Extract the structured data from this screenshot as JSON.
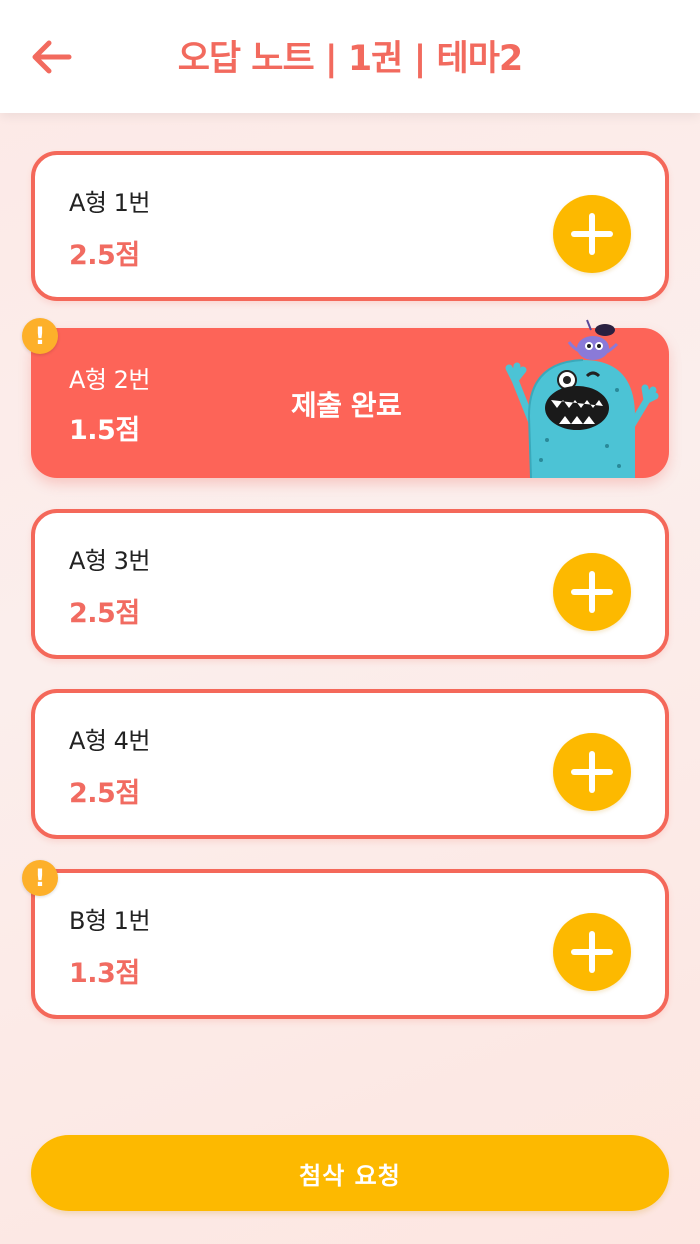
{
  "header": {
    "back_icon": "arrow-left-icon",
    "title": "오답 노트 | 1권 | 테마2"
  },
  "colors": {
    "accent": "#f26a5e",
    "card_border": "#f4685a",
    "done_fill": "#fd6458",
    "plus_button": "#fdb900",
    "alert_badge": "#fdb02a"
  },
  "cards": [
    {
      "name": "A형 1번",
      "score": "2.5점",
      "status": "",
      "action_icon": "plus-icon",
      "alert": false
    },
    {
      "name": "A형 2번",
      "score": "1.5점",
      "status": "제출 완료",
      "action_icon": "monster-illustration",
      "alert": true
    },
    {
      "name": "A형 3번",
      "score": "2.5점",
      "status": "",
      "action_icon": "plus-icon",
      "alert": false
    },
    {
      "name": "A형 4번",
      "score": "2.5점",
      "status": "",
      "action_icon": "plus-icon",
      "alert": false
    },
    {
      "name": "B형 1번",
      "score": "1.3점",
      "status": "",
      "action_icon": "plus-icon",
      "alert": true
    }
  ],
  "alert_mark": "!",
  "footer": {
    "submit_label": "첨삭 요청"
  }
}
